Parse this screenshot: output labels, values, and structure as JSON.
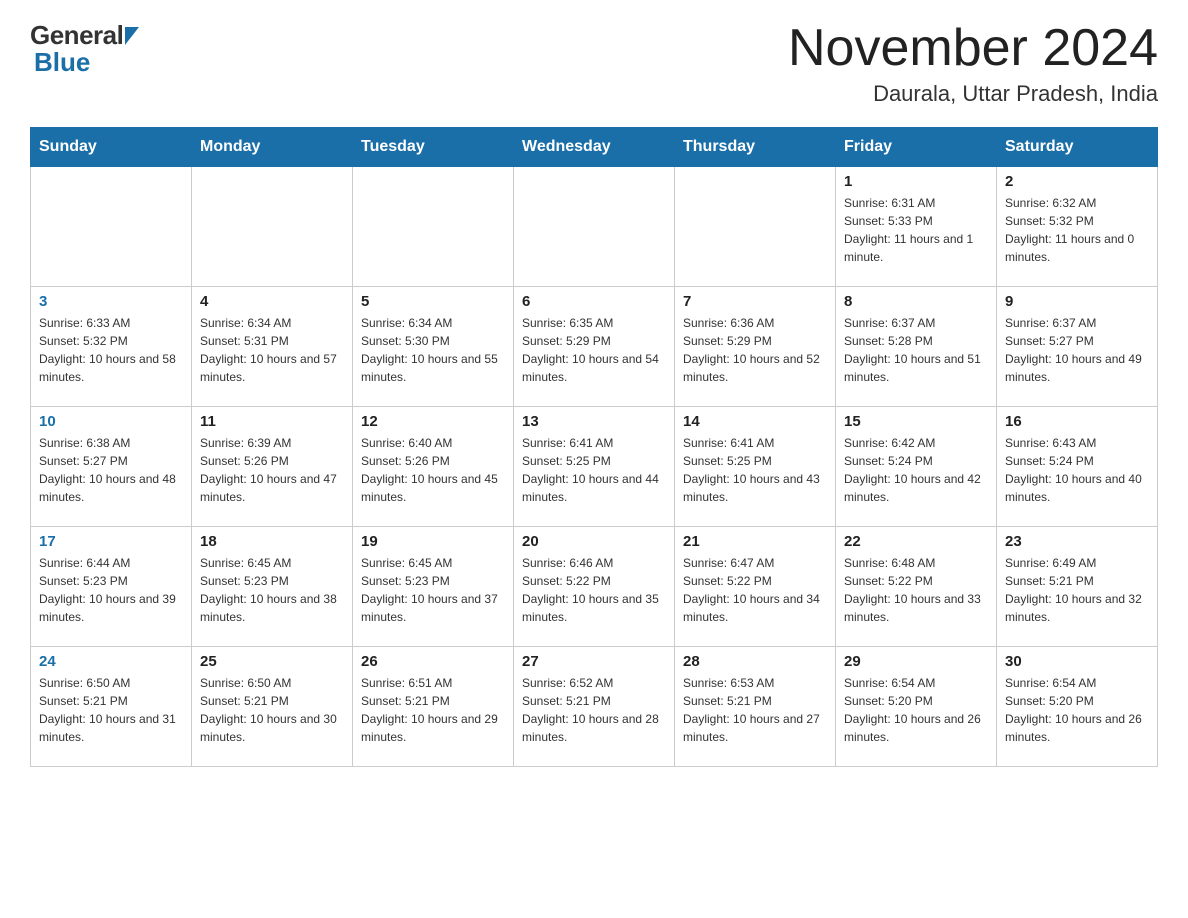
{
  "header": {
    "logo_general": "General",
    "logo_blue": "Blue",
    "title": "November 2024",
    "location": "Daurala, Uttar Pradesh, India"
  },
  "days_of_week": [
    "Sunday",
    "Monday",
    "Tuesday",
    "Wednesday",
    "Thursday",
    "Friday",
    "Saturday"
  ],
  "weeks": [
    [
      {
        "day": "",
        "info": ""
      },
      {
        "day": "",
        "info": ""
      },
      {
        "day": "",
        "info": ""
      },
      {
        "day": "",
        "info": ""
      },
      {
        "day": "",
        "info": ""
      },
      {
        "day": "1",
        "info": "Sunrise: 6:31 AM\nSunset: 5:33 PM\nDaylight: 11 hours and 1 minute."
      },
      {
        "day": "2",
        "info": "Sunrise: 6:32 AM\nSunset: 5:32 PM\nDaylight: 11 hours and 0 minutes."
      }
    ],
    [
      {
        "day": "3",
        "info": "Sunrise: 6:33 AM\nSunset: 5:32 PM\nDaylight: 10 hours and 58 minutes."
      },
      {
        "day": "4",
        "info": "Sunrise: 6:34 AM\nSunset: 5:31 PM\nDaylight: 10 hours and 57 minutes."
      },
      {
        "day": "5",
        "info": "Sunrise: 6:34 AM\nSunset: 5:30 PM\nDaylight: 10 hours and 55 minutes."
      },
      {
        "day": "6",
        "info": "Sunrise: 6:35 AM\nSunset: 5:29 PM\nDaylight: 10 hours and 54 minutes."
      },
      {
        "day": "7",
        "info": "Sunrise: 6:36 AM\nSunset: 5:29 PM\nDaylight: 10 hours and 52 minutes."
      },
      {
        "day": "8",
        "info": "Sunrise: 6:37 AM\nSunset: 5:28 PM\nDaylight: 10 hours and 51 minutes."
      },
      {
        "day": "9",
        "info": "Sunrise: 6:37 AM\nSunset: 5:27 PM\nDaylight: 10 hours and 49 minutes."
      }
    ],
    [
      {
        "day": "10",
        "info": "Sunrise: 6:38 AM\nSunset: 5:27 PM\nDaylight: 10 hours and 48 minutes."
      },
      {
        "day": "11",
        "info": "Sunrise: 6:39 AM\nSunset: 5:26 PM\nDaylight: 10 hours and 47 minutes."
      },
      {
        "day": "12",
        "info": "Sunrise: 6:40 AM\nSunset: 5:26 PM\nDaylight: 10 hours and 45 minutes."
      },
      {
        "day": "13",
        "info": "Sunrise: 6:41 AM\nSunset: 5:25 PM\nDaylight: 10 hours and 44 minutes."
      },
      {
        "day": "14",
        "info": "Sunrise: 6:41 AM\nSunset: 5:25 PM\nDaylight: 10 hours and 43 minutes."
      },
      {
        "day": "15",
        "info": "Sunrise: 6:42 AM\nSunset: 5:24 PM\nDaylight: 10 hours and 42 minutes."
      },
      {
        "day": "16",
        "info": "Sunrise: 6:43 AM\nSunset: 5:24 PM\nDaylight: 10 hours and 40 minutes."
      }
    ],
    [
      {
        "day": "17",
        "info": "Sunrise: 6:44 AM\nSunset: 5:23 PM\nDaylight: 10 hours and 39 minutes."
      },
      {
        "day": "18",
        "info": "Sunrise: 6:45 AM\nSunset: 5:23 PM\nDaylight: 10 hours and 38 minutes."
      },
      {
        "day": "19",
        "info": "Sunrise: 6:45 AM\nSunset: 5:23 PM\nDaylight: 10 hours and 37 minutes."
      },
      {
        "day": "20",
        "info": "Sunrise: 6:46 AM\nSunset: 5:22 PM\nDaylight: 10 hours and 35 minutes."
      },
      {
        "day": "21",
        "info": "Sunrise: 6:47 AM\nSunset: 5:22 PM\nDaylight: 10 hours and 34 minutes."
      },
      {
        "day": "22",
        "info": "Sunrise: 6:48 AM\nSunset: 5:22 PM\nDaylight: 10 hours and 33 minutes."
      },
      {
        "day": "23",
        "info": "Sunrise: 6:49 AM\nSunset: 5:21 PM\nDaylight: 10 hours and 32 minutes."
      }
    ],
    [
      {
        "day": "24",
        "info": "Sunrise: 6:50 AM\nSunset: 5:21 PM\nDaylight: 10 hours and 31 minutes."
      },
      {
        "day": "25",
        "info": "Sunrise: 6:50 AM\nSunset: 5:21 PM\nDaylight: 10 hours and 30 minutes."
      },
      {
        "day": "26",
        "info": "Sunrise: 6:51 AM\nSunset: 5:21 PM\nDaylight: 10 hours and 29 minutes."
      },
      {
        "day": "27",
        "info": "Sunrise: 6:52 AM\nSunset: 5:21 PM\nDaylight: 10 hours and 28 minutes."
      },
      {
        "day": "28",
        "info": "Sunrise: 6:53 AM\nSunset: 5:21 PM\nDaylight: 10 hours and 27 minutes."
      },
      {
        "day": "29",
        "info": "Sunrise: 6:54 AM\nSunset: 5:20 PM\nDaylight: 10 hours and 26 minutes."
      },
      {
        "day": "30",
        "info": "Sunrise: 6:54 AM\nSunset: 5:20 PM\nDaylight: 10 hours and 26 minutes."
      }
    ]
  ]
}
